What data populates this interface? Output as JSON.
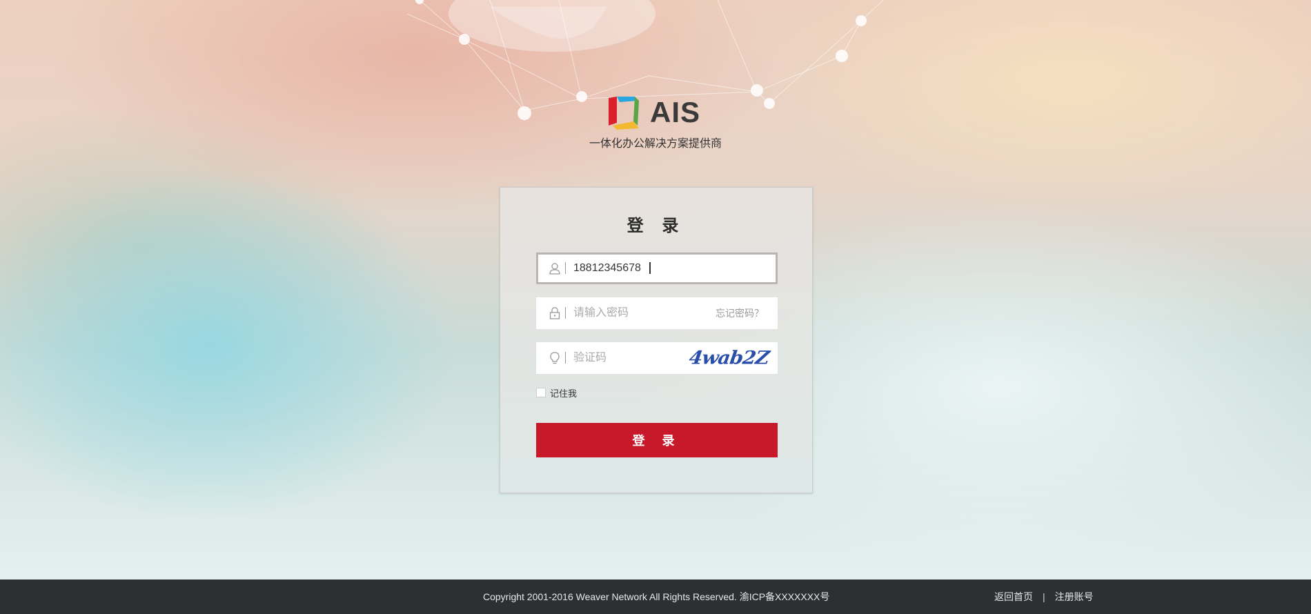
{
  "brand": {
    "name": "AIS",
    "slogan": "一体化办公解决方案提供商",
    "colors": {
      "red": "#d9212c",
      "blue": "#2aa7de",
      "yellow": "#f2b830",
      "green": "#5aa545"
    }
  },
  "login": {
    "title": "登 录",
    "username": {
      "value": "18812345678",
      "icon": "user-icon"
    },
    "password": {
      "placeholder": "请输入密码",
      "icon": "lock-icon",
      "forgot_label": "忘记密码？"
    },
    "captcha": {
      "placeholder": "验证码",
      "icon": "lightbulb-icon",
      "image_text": "4wab2Z"
    },
    "remember_label": "记住我",
    "submit_label": "登 录",
    "accent_color": "#c8192b"
  },
  "footer": {
    "copyright": "Copyright  2001-2016 Weaver Network All Rights Reserved.  渝ICP备XXXXXXX号",
    "links": {
      "home": "返回首页",
      "divider": "|",
      "register": "注册账号"
    }
  }
}
